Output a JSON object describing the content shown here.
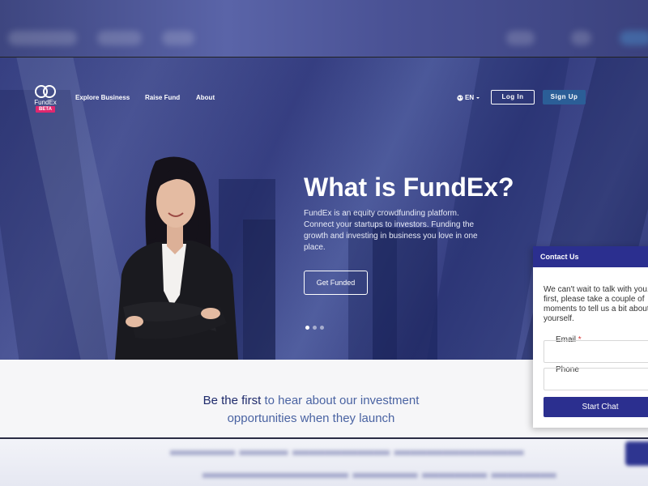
{
  "nav": {
    "logo_name": "FundEx",
    "logo_badge": "BETA",
    "links": [
      "Explore Business",
      "Raise Fund",
      "About"
    ],
    "language": "EN",
    "login_label": "Log In",
    "signup_label": "Sign Up"
  },
  "hero": {
    "title": "What is FundEx?",
    "description": "FundEx is an equity crowdfunding platform. Connect your startups to investors. Funding the growth and investing in business you love in one place.",
    "cta_label": "Get Funded",
    "slides_total": 3,
    "slide_active": 1
  },
  "tagline": {
    "strong": "Be the first",
    "rest_line1": "to hear about our investment",
    "line2": "opportunities when they launch"
  },
  "contact": {
    "header": "Contact Us",
    "message": "We can't wait to talk with you. first, please take a couple of moments to tell us a bit about yourself.",
    "email_label": "Email",
    "required_mark": "*",
    "phone_label": "Phone",
    "button_label": "Start Chat"
  },
  "colors": {
    "brand_navy": "#2b2f8f",
    "signup_blue": "#2b5e97",
    "beta_pink": "#e0276e",
    "tagline_blue": "#4a63a2"
  }
}
